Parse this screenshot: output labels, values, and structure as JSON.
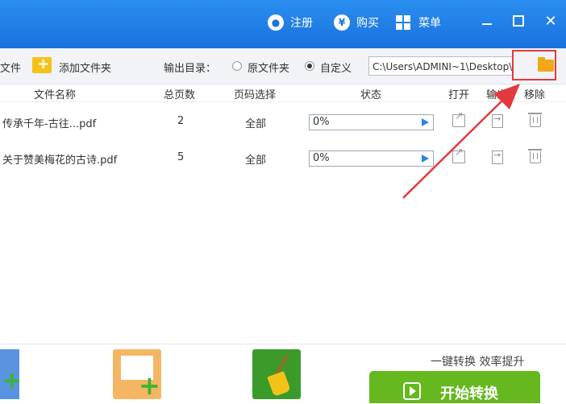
{
  "titlebar": {
    "register_label": "注册",
    "register_icon": "user-icon",
    "buy_label": "购买",
    "buy_icon": "yen-icon",
    "menu_label": "菜单",
    "menu_icon": "grid-icon"
  },
  "toolbar": {
    "add_file_label": "文件",
    "add_folder_label": "添加文件夹",
    "output_dir_label": "输出目录：",
    "option_original": "原文件夹",
    "option_custom": "自定义",
    "selected_option": "自定义",
    "path_value": "C:\\Users\\ADMINI~1\\Desktop\\"
  },
  "table": {
    "headers": {
      "name": "文件名称",
      "pages": "总页数",
      "range": "页码选择",
      "status": "状态",
      "open": "打开",
      "export": "输出",
      "remove": "移除"
    },
    "rows": [
      {
        "name": "传承千年-古往...pdf",
        "pages": "2",
        "range": "全部",
        "progress": "0%"
      },
      {
        "name": "关于赞美梅花的古诗.pdf",
        "pages": "5",
        "range": "全部",
        "progress": "0%"
      }
    ]
  },
  "footer": {
    "slogan": "一键转换  效率提升",
    "start_label": "开始转换"
  },
  "colors": {
    "titlebar": "#1a72dd",
    "start_button": "#65b81e",
    "highlight_red": "#e4393c"
  }
}
